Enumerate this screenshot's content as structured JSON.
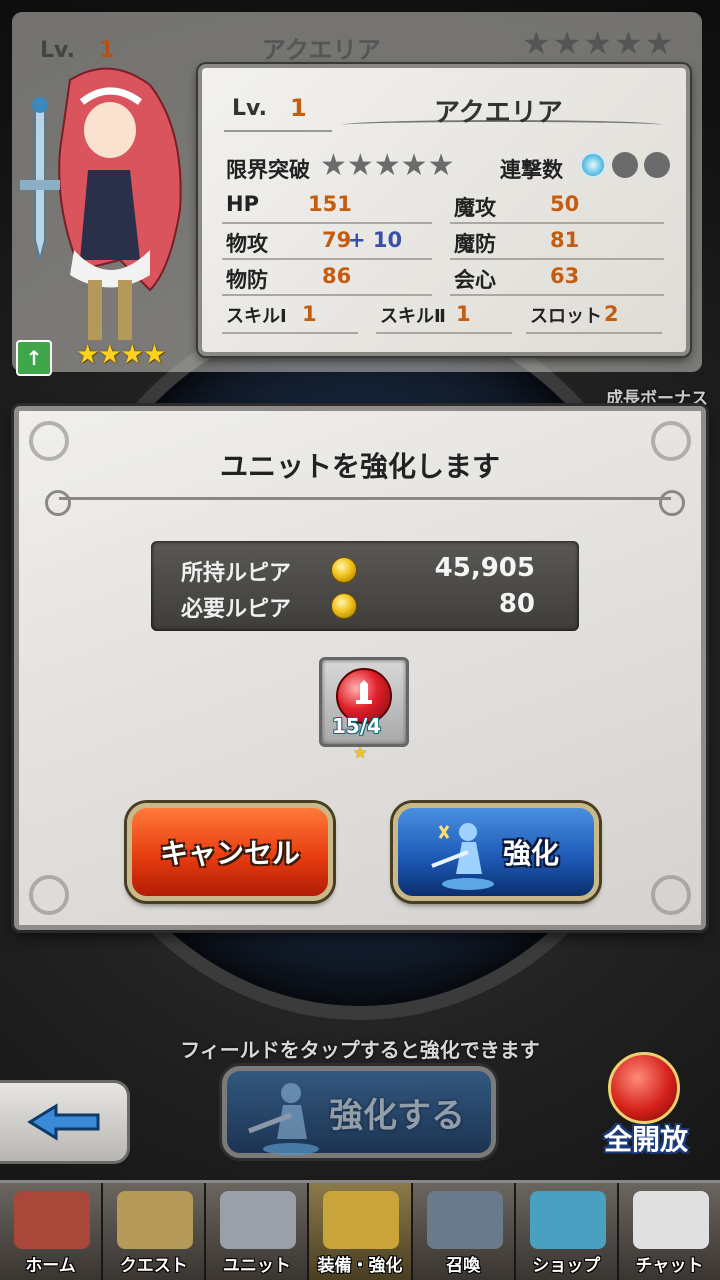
{
  "background": {
    "lv_label": "Lv.",
    "lv_value": "1",
    "name": "アクエリア",
    "stars": "★★★★★"
  },
  "character": {
    "rank_icon": "up-arrow-icon",
    "rarity": "★★★★"
  },
  "status": {
    "lv_label": "Lv.",
    "lv_value": "1",
    "name": "アクエリア",
    "limit_break_label": "限界突破",
    "limit_break_stars": "★★★★★",
    "combo_label": "連撃数",
    "combo_active": 1,
    "combo_total": 3,
    "hp_label": "HP",
    "hp_value": "151",
    "mag_atk_label": "魔攻",
    "mag_atk_value": "50",
    "phys_atk_label": "物攻",
    "phys_atk_value": "79",
    "phys_atk_bonus": "+ 10",
    "mag_def_label": "魔防",
    "mag_def_value": "81",
    "phys_def_label": "物防",
    "phys_def_value": "86",
    "crit_label": "会心",
    "crit_value": "63",
    "skill1_label": "スキルⅠ",
    "skill1_value": "1",
    "skill2_label": "スキルⅡ",
    "skill2_value": "1",
    "slot_label": "スロット",
    "slot_value": "2"
  },
  "growth_bonus": "成長ボーナス",
  "dialog": {
    "title": "ユニットを強化します",
    "owned_label": "所持ルピア",
    "owned_value": "45,905",
    "required_label": "必要ルピア",
    "required_value": "80",
    "item_count": "15/4",
    "item_star": "★",
    "cancel_label": "キャンセル",
    "enhance_label": "強化"
  },
  "hint": "フィールドをタップすると強化できます",
  "bottom": {
    "enhance_button": "強化する",
    "open_all": "全開放"
  },
  "nav": [
    {
      "label": "ホーム",
      "icon": "sofa-icon",
      "color": "#a8473a"
    },
    {
      "label": "クエスト",
      "icon": "map-icon",
      "color": "#b59a5a"
    },
    {
      "label": "ユニット",
      "icon": "knight-helmet-icon",
      "color": "#9aa0a8"
    },
    {
      "label": "装備・強化",
      "icon": "equipment-icon",
      "color": "#c9a43a"
    },
    {
      "label": "召喚",
      "icon": "gate-icon",
      "color": "#6a7a8a"
    },
    {
      "label": "ショップ",
      "icon": "treasure-chest-icon",
      "color": "#4aa0c0"
    },
    {
      "label": "チャット",
      "icon": "chat-bubble-icon",
      "color": "#e0e0e0"
    }
  ]
}
